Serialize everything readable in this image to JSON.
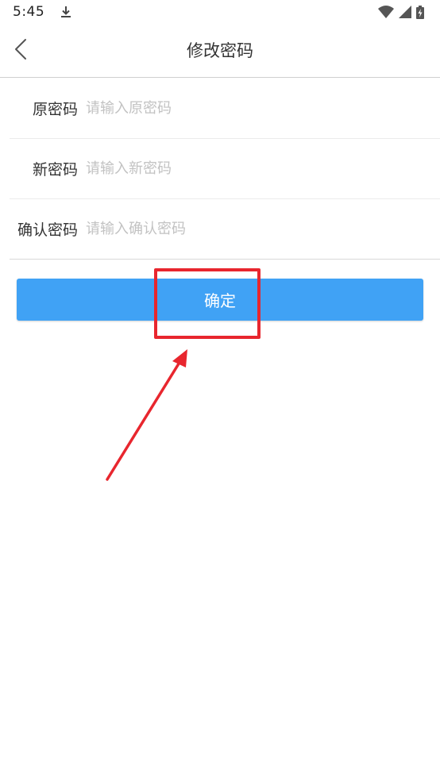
{
  "status_bar": {
    "time": "5:45",
    "icons": [
      "download-icon",
      "wifi-icon",
      "cellular-signal-icon",
      "battery-charging-icon"
    ]
  },
  "header": {
    "title": "修改密码",
    "back_icon": "chevron-left-icon"
  },
  "form": {
    "fields": [
      {
        "label": "原密码",
        "placeholder": "请输入原密码",
        "value": ""
      },
      {
        "label": "新密码",
        "placeholder": "请输入新密码",
        "value": ""
      },
      {
        "label": "确认密码",
        "placeholder": "请输入确认密码",
        "value": ""
      }
    ]
  },
  "actions": {
    "confirm_label": "确定"
  },
  "colors": {
    "accent": "#40a2f5",
    "annotation": "#e8262e",
    "divider": "#ebebeb",
    "placeholder": "#c2c2c2"
  }
}
